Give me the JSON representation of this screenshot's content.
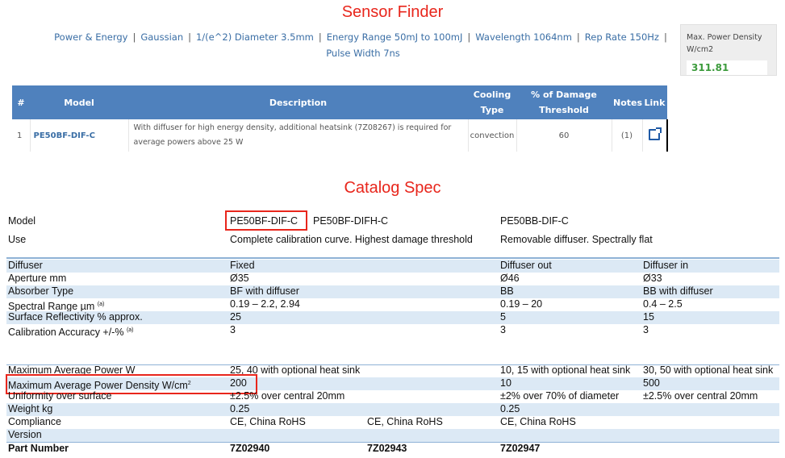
{
  "sensor_finder": {
    "title": "Sensor Finder",
    "filters": [
      "Power & Energy",
      "Gaussian",
      "1/(e^2) Diameter 3.5mm",
      "Energy Range 50mJ to 100mJ",
      "Wavelength 1064nm",
      "Rep Rate 150Hz",
      "Pulse Width 7ns"
    ],
    "max_power": {
      "label": "Max. Power Density W/cm2",
      "value": "311.81"
    },
    "table": {
      "headers": {
        "num": "#",
        "model": "Model",
        "description": "Description",
        "cooling": "Cooling Type",
        "damage": "% of Damage Threshold",
        "notes": "Notes",
        "link": "Link"
      },
      "rows": [
        {
          "num": "1",
          "model": "PE50BF-DIF-C",
          "description": "With diffuser for high energy density, additional heatsink (7Z08267) is required for average powers above 25 W",
          "cooling": "convection",
          "damage": "60",
          "notes": "(1)",
          "link_icon": "external-link-icon"
        }
      ]
    }
  },
  "catalog_spec": {
    "title": "Catalog Spec",
    "model_label": "Model",
    "models": [
      "PE50BF-DIF-C",
      "PE50BF-DIFH-C",
      "PE50BB-DIF-C"
    ],
    "use_label": "Use",
    "uses": [
      "Complete calibration curve. Highest damage threshold",
      "Removable diffuser. Spectrally flat"
    ],
    "rows": [
      {
        "label": "Diffuser",
        "c1": "Fixed",
        "c2": "",
        "c3": "Diffuser out",
        "c4": "Diffuser in"
      },
      {
        "label": "Aperture mm",
        "c1": "Ø35",
        "c2": "",
        "c3": "Ø46",
        "c4": "Ø33"
      },
      {
        "label": "Absorber Type",
        "c1": "BF with diffuser",
        "c2": "",
        "c3": "BB",
        "c4": "BB with diffuser"
      },
      {
        "label": "Spectral Range µm",
        "sup": "(a)",
        "c1": "0.19 – 2.2, 2.94",
        "c2": "",
        "c3": "0.19 – 20",
        "c4": "0.4 – 2.5"
      },
      {
        "label": "Surface Reflectivity % approx.",
        "c1": "25",
        "c2": "",
        "c3": "5",
        "c4": "15"
      },
      {
        "label": "Calibration Accuracy +/-%",
        "sup": "(a)",
        "c1": "3",
        "c2": "",
        "c3": "3",
        "c4": "3"
      }
    ],
    "rows2": [
      {
        "label": "Maximum Average Power W",
        "c1": "25, 40 with optional heat sink",
        "c2": "",
        "c3": "10, 15 with optional heat sink",
        "c4": "30, 50 with optional heat sink"
      },
      {
        "label": "Maximum Average Power Density W/cm",
        "sup": "2",
        "c1": "200",
        "c2": "",
        "c3": "10",
        "c4": "500"
      },
      {
        "label": "Uniformity over surface",
        "c1": "±2.5% over central 20mm",
        "c2": "",
        "c3": "±2% over 70% of diameter",
        "c4": "±2.5% over central 20mm"
      },
      {
        "label": "Weight kg",
        "c1": "0.25",
        "c2": "",
        "c3": "0.25",
        "c4": ""
      },
      {
        "label": "Compliance",
        "c1": "CE, China RoHS",
        "c2": "CE, China RoHS",
        "c3": "CE, China RoHS",
        "c4": ""
      },
      {
        "label": "Version",
        "c1": "",
        "c2": "",
        "c3": "",
        "c4": ""
      }
    ],
    "part_number_label": "Part Number",
    "part_numbers": [
      "7Z02940",
      "7Z02943",
      "7Z02947"
    ]
  }
}
